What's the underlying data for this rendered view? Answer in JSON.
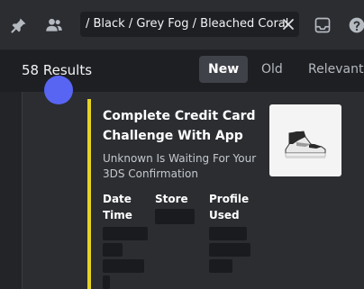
{
  "header": {
    "search_query": "/ Black / Grey Fog / Bleached Coral",
    "icons": [
      "pin-icon",
      "members-icon",
      "close-icon",
      "inbox-icon",
      "help-icon"
    ]
  },
  "results": {
    "count_label": "58 Results",
    "tabs": [
      {
        "label": "New",
        "active": true
      },
      {
        "label": "Old",
        "active": false
      },
      {
        "label": "Relevant",
        "active": false
      }
    ]
  },
  "embed": {
    "title": "Complete Credit Card Challenge With App",
    "description": "Unknown Is Waiting For Your 3DS Confirmation",
    "accent_color": "#e5d424",
    "fields": {
      "date_time": "Date Time",
      "store": "Store",
      "profile_used": "Profile Used"
    },
    "thumbnail": "sneaker-image"
  },
  "colors": {
    "background": "#2b2d31",
    "results_bar": "#1e1f22",
    "avatar": "#5865f2"
  }
}
